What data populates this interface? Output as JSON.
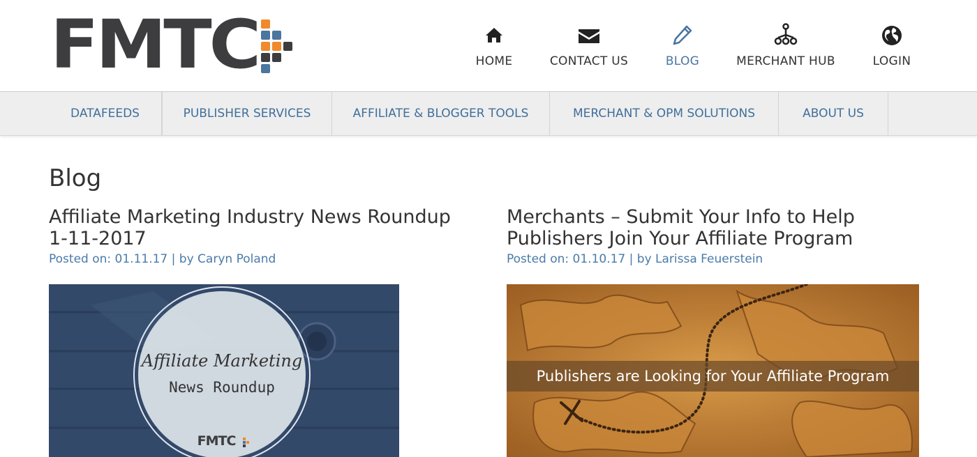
{
  "brand": {
    "logo_text": "FMTC",
    "accent_blue": "#4a76a0",
    "accent_orange": "#f08a2c",
    "logo_gray": "#3d3d3f"
  },
  "topnav": {
    "items": [
      {
        "label": "HOME",
        "icon": "home-icon"
      },
      {
        "label": "CONTACT US",
        "icon": "envelope-icon"
      },
      {
        "label": "BLOG",
        "icon": "pencil-icon",
        "active": true
      },
      {
        "label": "MERCHANT HUB",
        "icon": "network-icon"
      },
      {
        "label": "LOGIN",
        "icon": "globe-icon"
      }
    ]
  },
  "subnav": {
    "items": [
      {
        "label": "DATAFEEDS"
      },
      {
        "label": "PUBLISHER SERVICES"
      },
      {
        "label": "AFFILIATE & BLOGGER TOOLS"
      },
      {
        "label": "MERCHANT & OPM SOLUTIONS"
      },
      {
        "label": "ABOUT US"
      }
    ]
  },
  "page": {
    "title": "Blog"
  },
  "posts": [
    {
      "title": "Affiliate Marketing Industry News Roundup 1-11-2017",
      "posted_prefix": "Posted on: ",
      "date": "01.11.17",
      "separator": " | ",
      "by_prefix": "by ",
      "author": "Caryn Poland",
      "image": {
        "script_text": "Affiliate Marketing",
        "sub_text": "News Roundup",
        "badge_text": "FMTC"
      }
    },
    {
      "title": "Merchants – Submit Your Info to Help Publishers Join Your Affiliate Program",
      "posted_prefix": "Posted on: ",
      "date": "01.10.17",
      "separator": " | ",
      "by_prefix": "by ",
      "author": "Larissa Feuerstein",
      "image": {
        "banner_text": "Publishers are Looking for Your Affiliate Program"
      }
    }
  ]
}
